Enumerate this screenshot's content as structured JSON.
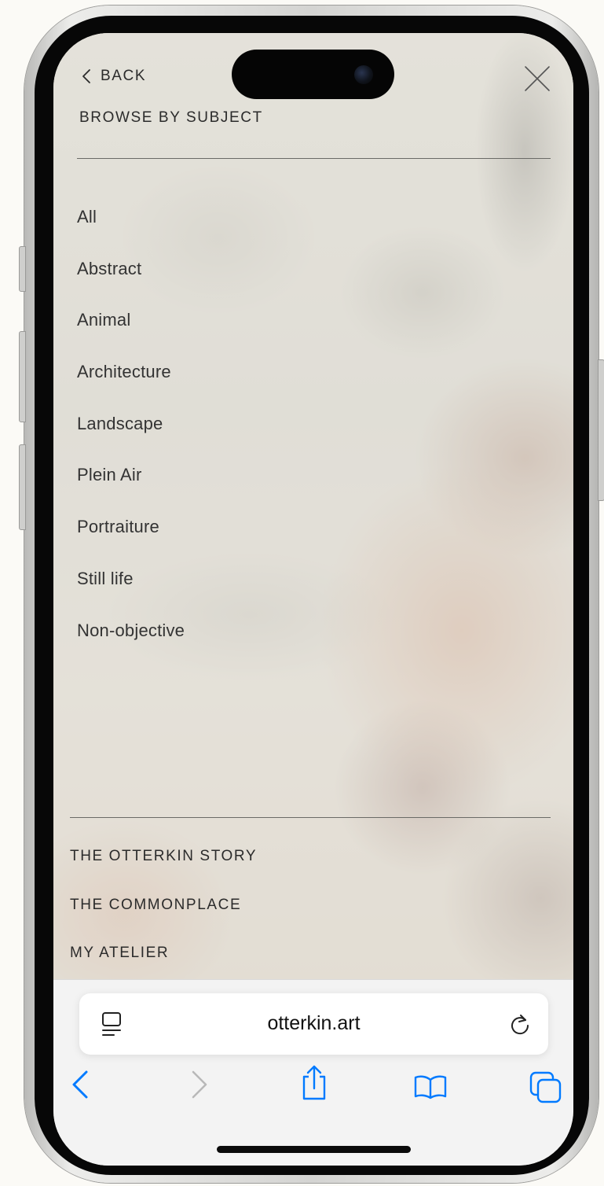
{
  "menu": {
    "back_label": "BACK",
    "section_title": "BROWSE BY SUBJECT",
    "subjects": [
      "All",
      "Abstract",
      "Animal",
      "Architecture",
      "Landscape",
      "Plein Air",
      "Portraiture",
      "Still life",
      "Non-objective"
    ],
    "footer_links": [
      "THE OTTERKIN STORY",
      "THE COMMONPLACE",
      "MY ATELIER"
    ]
  },
  "browser": {
    "url": "otterkin.art",
    "accent_color": "#007aff",
    "icons": [
      "reader-mode-icon",
      "reload-icon",
      "back-arrow-icon",
      "forward-arrow-icon",
      "share-icon",
      "bookmarks-icon",
      "tabs-icon"
    ]
  }
}
